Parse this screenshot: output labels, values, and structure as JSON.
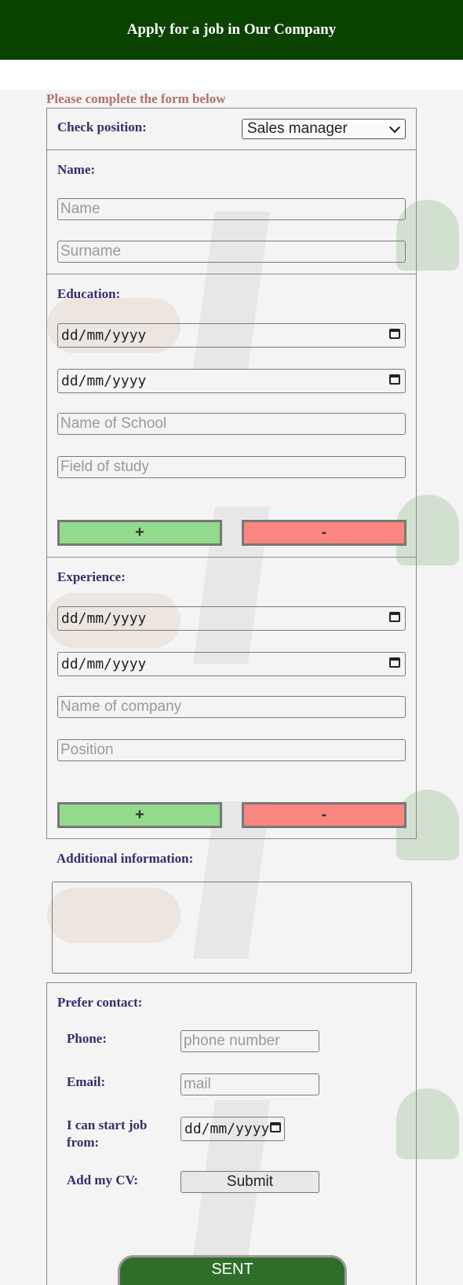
{
  "header": {
    "title": "Apply for a job in Our Company"
  },
  "intro": "Please complete the form below",
  "position": {
    "label": "Check position:",
    "selected": "Sales manager"
  },
  "name": {
    "label": "Name:",
    "name_placeholder": "Name",
    "surname_placeholder": "Surname"
  },
  "education": {
    "label": "Education:",
    "date_from": "dd/mm/yyyy",
    "date_to": "dd/mm/yyyy",
    "school_placeholder": "Name of School",
    "field_placeholder": "Field of study",
    "add_label": "+",
    "remove_label": "-"
  },
  "experience": {
    "label": "Experience:",
    "date_from": "dd/mm/yyyy",
    "date_to": "dd/mm/yyyy",
    "company_placeholder": "Name of company",
    "position_placeholder": "Position",
    "add_label": "+",
    "remove_label": "-"
  },
  "additional": {
    "label": "Additional information:"
  },
  "contact": {
    "label": "Prefer contact:",
    "phone_label": "Phone:",
    "phone_placeholder": "phone number",
    "email_label": "Email:",
    "email_placeholder": "mail",
    "start_label": "I can start job from:",
    "start_date": "dd/mm/yyyy",
    "cv_label": "Add my CV:",
    "cv_button": "Submit"
  },
  "sent_button": "SENT",
  "colors": {
    "header": "#0a4200",
    "plus": "#93db8c",
    "minus": "#fb8580",
    "sent": "#2e6e2a",
    "label": "#3a2a6a"
  },
  "icons": {
    "date": "calendar-icon",
    "select": "chevron-down-icon"
  }
}
